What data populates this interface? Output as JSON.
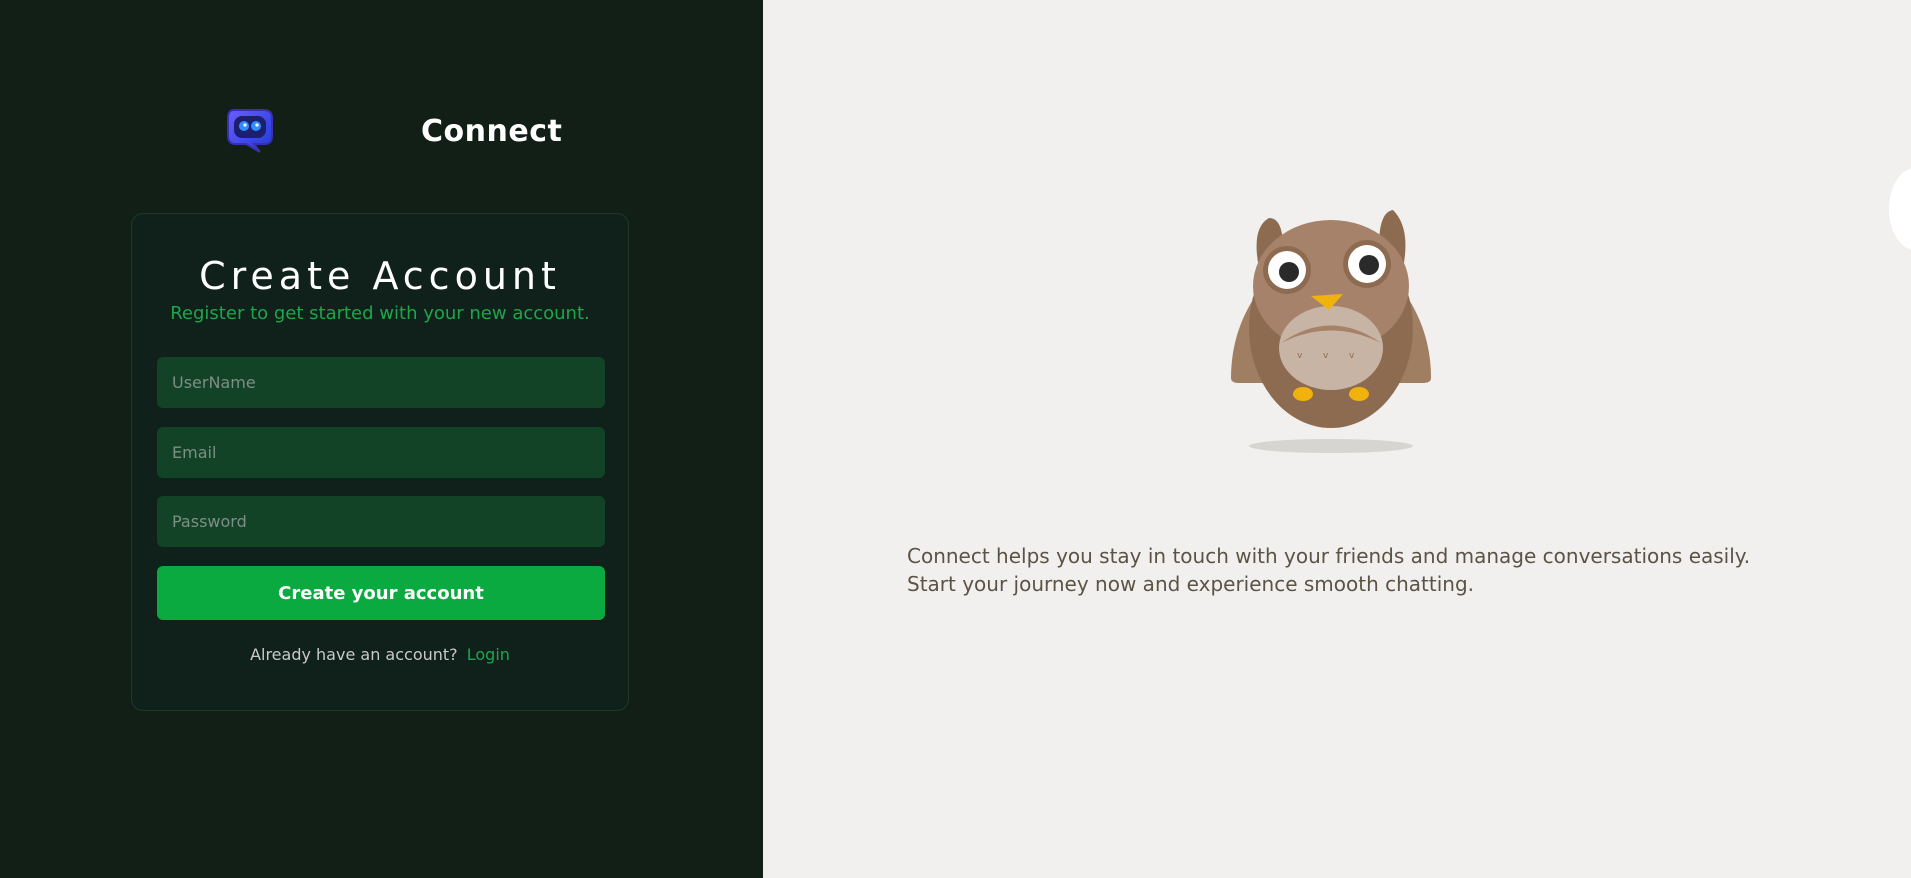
{
  "brand": {
    "name": "Connect",
    "logo_icon": "chat-bubble-robot-icon"
  },
  "form": {
    "title": "Create Account",
    "subtitle": "Register to get started with your new account.",
    "username_placeholder": "UserName",
    "email_placeholder": "Email",
    "password_placeholder": "Password",
    "submit_label": "Create your account",
    "login_prompt": "Already have an account?",
    "login_link": "Login"
  },
  "hero": {
    "illustration": "owl-icon",
    "tagline": "Connect helps you stay in touch with your friends and manage conversations easily. Start your journey now and experience smooth chatting."
  },
  "colors": {
    "left_panel_bg": "#111f17",
    "right_panel_bg": "#f1f0ee",
    "accent_green": "#0aaa41",
    "field_bg": "#134326",
    "subtitle_green": "#1fa64a"
  }
}
